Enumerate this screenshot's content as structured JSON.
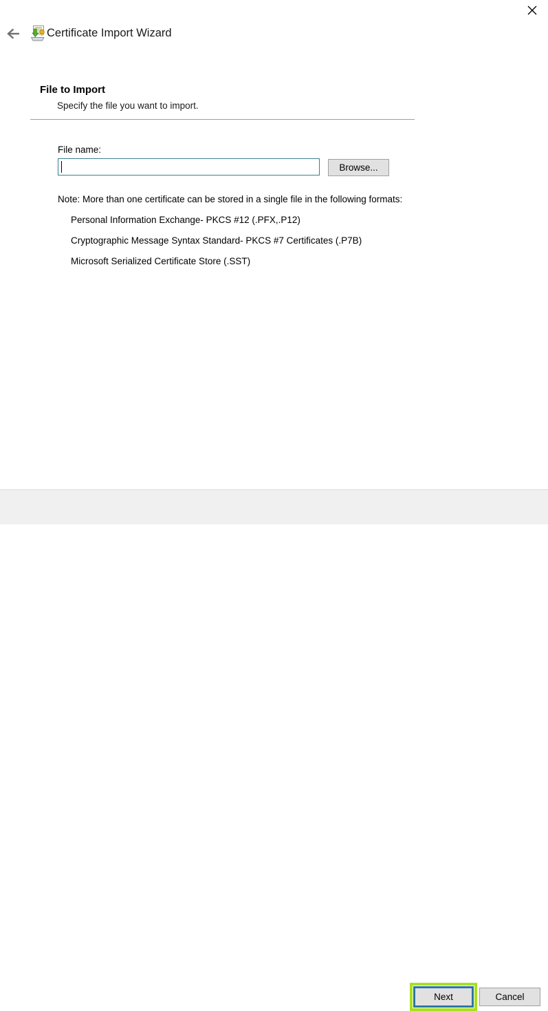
{
  "window": {
    "title": "Certificate Import Wizard",
    "icon": "certificate-import-icon",
    "back_icon": "back-arrow-icon",
    "close_icon": "close-icon"
  },
  "page": {
    "title": "File to Import",
    "subtitle": "Specify the file you want to import."
  },
  "form": {
    "file_name_label": "File name:",
    "file_name_value": "",
    "file_name_placeholder": "",
    "browse_label": "Browse..."
  },
  "note": {
    "lead": "Note:  More than one certificate can be stored in a single file in the following formats:",
    "formats": [
      "Personal Information Exchange- PKCS #12 (.PFX,.P12)",
      "Cryptographic Message Syntax Standard- PKCS #7 Certificates (.P7B)",
      "Microsoft Serialized Certificate Store (.SST)"
    ]
  },
  "footer": {
    "next_label": "Next",
    "cancel_label": "Cancel"
  },
  "colors": {
    "highlight_green": "#A8E01E",
    "focus_blue": "#2E75A8",
    "input_border_teal": "#3C7D8E",
    "button_face": "#E1E1E1",
    "footer_bg": "#F0F0F0"
  }
}
